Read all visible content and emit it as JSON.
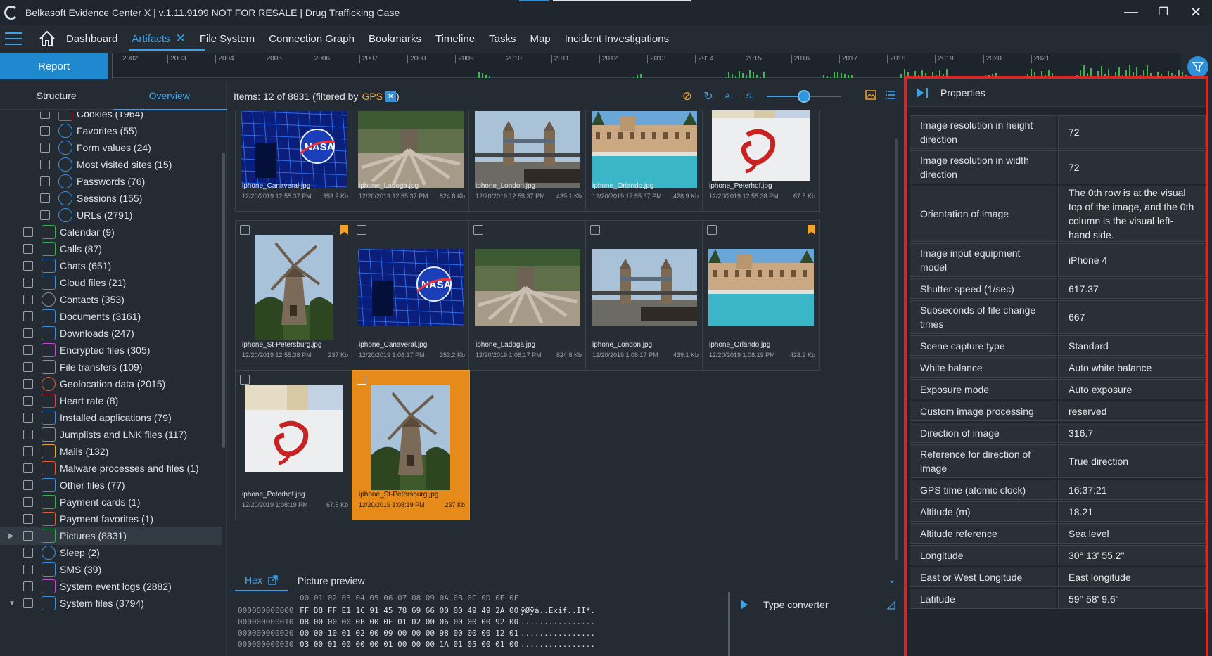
{
  "window": {
    "title": "Belkasoft Evidence Center X | v.1.11.9199 NOT FOR RESALE | Drug Trafficking Case",
    "minimize": "—",
    "restore": "❐",
    "close": "✕"
  },
  "menu": {
    "items": [
      "Dashboard",
      "Artifacts",
      "File System",
      "Connection Graph",
      "Bookmarks",
      "Timeline",
      "Tasks",
      "Map",
      "Incident Investigations"
    ],
    "active": "Artifacts",
    "close_glyph": "✕"
  },
  "report_label": "Report",
  "timeline": {
    "years": [
      "2002",
      "2003",
      "2004",
      "2005",
      "2006",
      "2007",
      "2008",
      "2009",
      "2010",
      "2011",
      "2012",
      "2013",
      "2014",
      "2015",
      "2016",
      "2017",
      "2018",
      "2019",
      "2020",
      "2021"
    ]
  },
  "left_tabs": [
    "Structure",
    "Overview"
  ],
  "tree": [
    {
      "label": "Cookies (1964)",
      "indent": 2,
      "icon": "cookie-icon",
      "color": "#e0445a"
    },
    {
      "label": "Favorites (55)",
      "indent": 2,
      "icon": "star-globe-icon",
      "color": "#3a8fe0"
    },
    {
      "label": "Form values (24)",
      "indent": 2,
      "icon": "globe-icon",
      "color": "#3a8fe0"
    },
    {
      "label": "Most visited sites (15)",
      "indent": 2,
      "icon": "globe-top-icon",
      "color": "#3a8fe0"
    },
    {
      "label": "Passwords (76)",
      "indent": 2,
      "icon": "globe-key-icon",
      "color": "#3a8fe0"
    },
    {
      "label": "Sessions (155)",
      "indent": 2,
      "icon": "history-icon",
      "color": "#3a8fe0"
    },
    {
      "label": "URLs (2791)",
      "indent": 2,
      "icon": "globe-icon",
      "color": "#3a8fe0"
    },
    {
      "label": "Calendar (9)",
      "indent": 1,
      "icon": "calendar-icon",
      "color": "#2fb34a"
    },
    {
      "label": "Calls (87)",
      "indent": 1,
      "icon": "phone-icon",
      "color": "#2fb34a"
    },
    {
      "label": "Chats (651)",
      "indent": 1,
      "icon": "chat-icon",
      "color": "#3a8fe0"
    },
    {
      "label": "Cloud files (21)",
      "indent": 1,
      "icon": "cloud-icon",
      "color": "#3a8fe0"
    },
    {
      "label": "Contacts (353)",
      "indent": 1,
      "icon": "contact-icon",
      "color": "#8a939d"
    },
    {
      "label": "Documents (3161)",
      "indent": 1,
      "icon": "document-icon",
      "color": "#3a8fe0"
    },
    {
      "label": "Downloads (247)",
      "indent": 1,
      "icon": "download-icon",
      "color": "#3a8fe0"
    },
    {
      "label": "Encrypted files (305)",
      "indent": 1,
      "icon": "lock-icon",
      "color": "#c94ad0"
    },
    {
      "label": "File transfers (109)",
      "indent": 1,
      "icon": "file-transfer-icon",
      "color": "#8a939d"
    },
    {
      "label": "Geolocation data (2015)",
      "indent": 1,
      "icon": "geolocation-icon",
      "color": "#e85a2a"
    },
    {
      "label": "Heart rate (8)",
      "indent": 1,
      "icon": "heart-icon",
      "color": "#e0445a"
    },
    {
      "label": "Installed applications (79)",
      "indent": 1,
      "icon": "app-icon",
      "color": "#3a8fe0"
    },
    {
      "label": "Jumplists and LNK files (117)",
      "indent": 1,
      "icon": "link-icon",
      "color": "#8a939d"
    },
    {
      "label": "Mails (132)",
      "indent": 1,
      "icon": "at-icon",
      "color": "#f0a32b"
    },
    {
      "label": "Malware processes and files (1)",
      "indent": 1,
      "icon": "bug-icon",
      "color": "#e85a2a"
    },
    {
      "label": "Other files (77)",
      "indent": 1,
      "icon": "file-icon",
      "color": "#3a8fe0"
    },
    {
      "label": "Payment cards (1)",
      "indent": 1,
      "icon": "card-icon",
      "color": "#2fb34a"
    },
    {
      "label": "Payment favorites (1)",
      "indent": 1,
      "icon": "card-fav-icon",
      "color": "#e85a2a"
    },
    {
      "label": "Pictures (8831)",
      "indent": 1,
      "icon": "picture-icon",
      "color": "#2fb34a",
      "selected": true,
      "expander": "▶"
    },
    {
      "label": "Sleep (2)",
      "indent": 1,
      "icon": "sleep-icon",
      "color": "#3a8fe0"
    },
    {
      "label": "SMS (39)",
      "indent": 1,
      "icon": "sms-icon",
      "color": "#3a8fe0"
    },
    {
      "label": "System event logs (2882)",
      "indent": 1,
      "icon": "log-icon",
      "color": "#c94ad0"
    },
    {
      "label": "System files (3794)",
      "indent": 1,
      "icon": "system-files-icon",
      "color": "#3a8fe0",
      "expander": "▼"
    }
  ],
  "items_header": {
    "prefix": "Items: 12 of 8831 (filtered by",
    "filter": "GPS",
    "filter_x": "✕",
    "suffix": ")"
  },
  "toolbar_glyphs": {
    "clear": "⊘",
    "refresh": "↻",
    "sort_az": "A↓",
    "sort_size": "S↓"
  },
  "tiles": [
    {
      "name": "iphone_Canaveral.jpg",
      "date": "12/20/2019 12:55:37 PM",
      "size": "353.2 Kb",
      "img": "nasa"
    },
    {
      "name": "iphone_Ladoga.jpg",
      "date": "12/20/2019 12:55:37 PM",
      "size": "824.8 Kb",
      "img": "roots"
    },
    {
      "name": "iphone_London.jpg",
      "date": "12/20/2019 12:55:37 PM",
      "size": "439.1 Kb",
      "img": "bridge"
    },
    {
      "name": "iphone_Orlando.jpg",
      "date": "12/20/2019 12:55:37 PM",
      "size": "428.9 Kb",
      "img": "pool"
    },
    {
      "name": "iphone_Peterhof.jpg",
      "date": "12/20/2019 12:55:38 PM",
      "size": "67.5 Kb",
      "img": "peterhof"
    },
    {
      "name": "iphone_St-Petersburg.jpg",
      "date": "12/20/2019 12:55:38 PM",
      "size": "237 Kb",
      "img": "windmill",
      "bookmark": true
    },
    {
      "name": "iphone_Canaveral.jpg",
      "date": "12/20/2019 1:08:17 PM",
      "size": "353.2 Kb",
      "img": "nasa"
    },
    {
      "name": "iphone_Ladoga.jpg",
      "date": "12/20/2019 1:08:17 PM",
      "size": "824.8 Kb",
      "img": "roots"
    },
    {
      "name": "iphone_London.jpg",
      "date": "12/20/2019 1:08:17 PM",
      "size": "439.1 Kb",
      "img": "bridge"
    },
    {
      "name": "iphone_Orlando.jpg",
      "date": "12/20/2019 1:08:19 PM",
      "size": "428.9 Kb",
      "img": "pool",
      "bookmark": true
    },
    {
      "name": "iphone_Peterhof.jpg",
      "date": "12/20/2019 1:08:19 PM",
      "size": "67.5 Kb",
      "img": "peterhof"
    },
    {
      "name": "iphone_St-Petersburg.jpg",
      "date": "12/20/2019 1:08:19 PM",
      "size": "237 Kb",
      "img": "windmill",
      "selected": true
    }
  ],
  "bottom_tabs": [
    "Hex",
    "Picture preview"
  ],
  "hex": {
    "header": "00 01 02 03 04 05 06 07 08 09 0A 0B 0C 0D 0E 0F",
    "rows": [
      {
        "offset": "000000000000",
        "bytes": "FF D8 FF E1 1C 91 45 78 69 66 00 00 49 49 2A 00",
        "ascii": "ÿØÿá..Exif..II*."
      },
      {
        "offset": "000000000010",
        "bytes": "08 00 00 00 0B 00 0F 01 02 00 06 00 00 00 92 00",
        "ascii": "................"
      },
      {
        "offset": "000000000020",
        "bytes": "00 00 10 01 02 00 09 00 00 00 98 00 00 00 12 01",
        "ascii": "................"
      },
      {
        "offset": "000000000030",
        "bytes": "03 00 01 00 00 00 01 00 00 00 1A 01 05 00 01 00",
        "ascii": "................"
      }
    ]
  },
  "type_converter": "Type converter",
  "properties": {
    "title": "Properties",
    "rows": [
      {
        "name": "Image resolution in height direction",
        "value": "72"
      },
      {
        "name": "Image resolution in width direction",
        "value": "72"
      },
      {
        "name": "Orientation of image",
        "value": "The 0th row is at the visual top of the image, and the 0th column is the visual left-hand side."
      },
      {
        "name": "Image input equipment model",
        "value": "iPhone 4"
      },
      {
        "name": "Shutter speed (1/sec)",
        "value": "617.37"
      },
      {
        "name": "Subseconds of file change times",
        "value": "667"
      },
      {
        "name": "Scene capture type",
        "value": "Standard"
      },
      {
        "name": "White balance",
        "value": "Auto white balance"
      },
      {
        "name": "Exposure mode",
        "value": "Auto exposure"
      },
      {
        "name": "Custom image processing",
        "value": "reserved"
      },
      {
        "name": "Direction of image",
        "value": "316.7"
      },
      {
        "name": "Reference for direction of image",
        "value": "True direction"
      },
      {
        "name": "GPS time (atomic clock)",
        "value": "16:37:21"
      },
      {
        "name": "Altitude (m)",
        "value": "18.21"
      },
      {
        "name": "Altitude reference",
        "value": "Sea level"
      },
      {
        "name": "Longitude",
        "value": "30° 13' 55.2\""
      },
      {
        "name": "East or West Longitude",
        "value": "East longitude"
      },
      {
        "name": "Latitude",
        "value": "59° 58' 9.6\""
      }
    ]
  }
}
